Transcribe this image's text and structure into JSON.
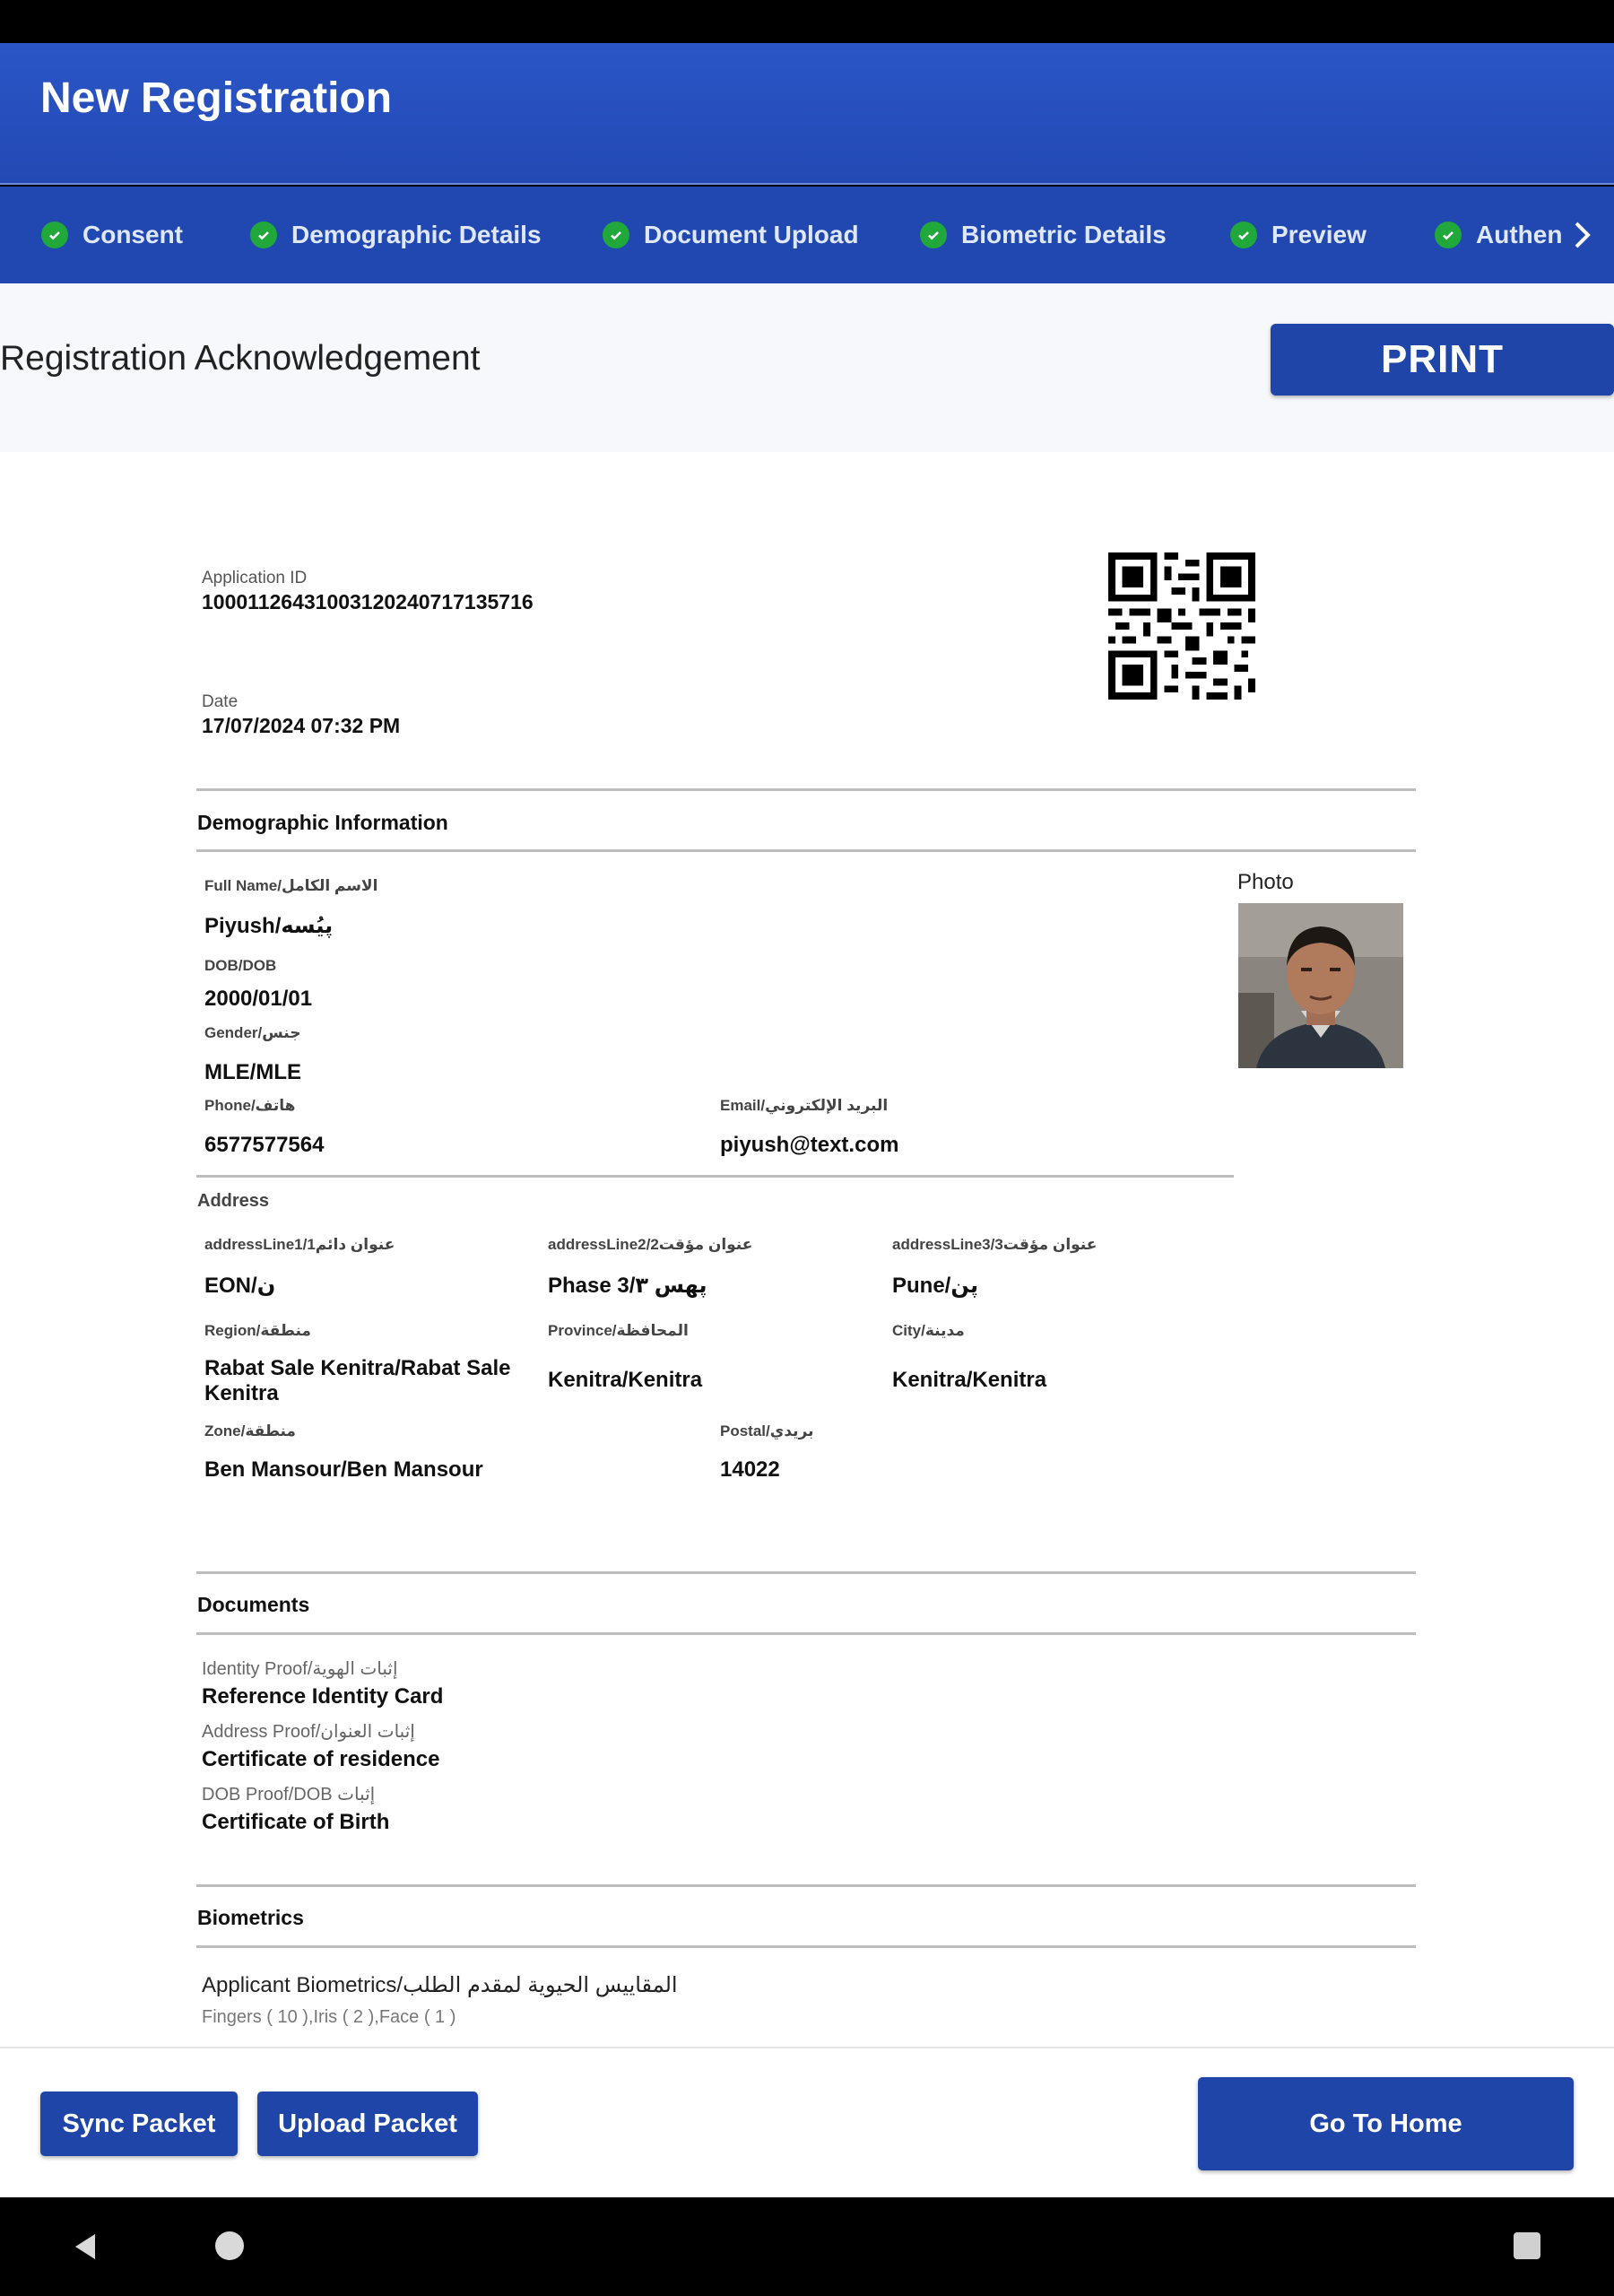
{
  "header": {
    "title": "New Registration"
  },
  "stepper": {
    "steps": [
      {
        "label": "Consent"
      },
      {
        "label": "Demographic Details"
      },
      {
        "label": "Document Upload"
      },
      {
        "label": "Biometric Details"
      },
      {
        "label": "Preview"
      },
      {
        "label": "Authent"
      }
    ]
  },
  "ack": {
    "title": "Registration Acknowledgement",
    "print_label": "PRINT"
  },
  "application": {
    "id_label": "Application ID",
    "id_value": "10001126431003120240717135716",
    "date_label": "Date",
    "date_value": "17/07/2024 07:32 PM"
  },
  "demographic": {
    "title": "Demographic Information",
    "photo_label": "Photo",
    "full_name_label": "Full Name/الاسم الكامل",
    "full_name_value": "Piyush/پیُسه",
    "dob_label": "DOB/DOB",
    "dob_value": "2000/01/01",
    "gender_label": "Gender/جنس",
    "gender_value": "MLE/MLE",
    "phone_label": "Phone/هاتف",
    "phone_value": "6577577564",
    "email_label": "Email/البريد الإلكتروني",
    "email_value": "piyush@text.com"
  },
  "address": {
    "title": "Address",
    "line1_label": "addressLine1/1عنوان دائم",
    "line1_value": "EON/ن",
    "line2_label": "addressLine2/2عنوان مؤقت",
    "line2_value": "Phase 3/پهس ۳",
    "line3_label": "addressLine3/3عنوان مؤقت",
    "line3_value": "Pune/پن",
    "region_label": "Region/منطقة",
    "region_value": "Rabat Sale Kenitra/Rabat Sale Kenitra",
    "province_label": "Province/المحافظة",
    "province_value": "Kenitra/Kenitra",
    "city_label": "City/مدينة",
    "city_value": "Kenitra/Kenitra",
    "zone_label": "Zone/منطقة",
    "zone_value": "Ben Mansour/Ben Mansour",
    "postal_label": "Postal/بريدي",
    "postal_value": "14022"
  },
  "documents": {
    "title": "Documents",
    "identity_label": "Identity Proof/إثبات الهوية",
    "identity_value": "Reference Identity Card",
    "address_label": "Address Proof/إثبات العنوان",
    "address_value": "Certificate of residence",
    "dob_label": "DOB Proof/DOB إثبات",
    "dob_value": "Certificate of Birth"
  },
  "biometrics": {
    "title": "Biometrics",
    "applicant_label": "Applicant Biometrics/المقاييس الحيوية لمقدم الطلب",
    "summary": "Fingers ( 10 ),Iris ( 2 ),Face ( 1 )"
  },
  "actions": {
    "sync_label": "Sync Packet",
    "upload_label": "Upload Packet",
    "home_label": "Go To Home"
  },
  "colors": {
    "primary": "#1f45a8",
    "header": "#2a56c6",
    "check": "#21a83a"
  }
}
